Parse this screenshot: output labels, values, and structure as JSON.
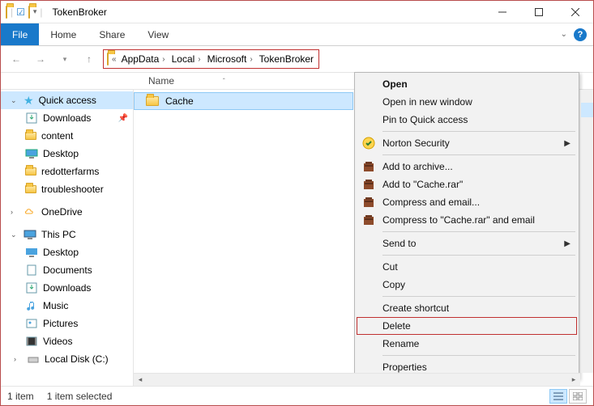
{
  "window": {
    "title": "TokenBroker"
  },
  "ribbon": {
    "file": "File",
    "tabs": [
      "Home",
      "Share",
      "View"
    ]
  },
  "breadcrumb": {
    "overflow": "«",
    "parts": [
      "AppData",
      "Local",
      "Microsoft",
      "TokenBroker"
    ]
  },
  "columns": {
    "name": "Name"
  },
  "nav": {
    "quick": {
      "label": "Quick access",
      "items": [
        {
          "label": "Downloads",
          "pinned": true
        },
        {
          "label": "content"
        },
        {
          "label": "Desktop"
        },
        {
          "label": "redotterfarms"
        },
        {
          "label": "troubleshooter"
        }
      ]
    },
    "onedrive": {
      "label": "OneDrive"
    },
    "thispc": {
      "label": "This PC",
      "items": [
        {
          "label": "Desktop"
        },
        {
          "label": "Documents"
        },
        {
          "label": "Downloads"
        },
        {
          "label": "Music"
        },
        {
          "label": "Pictures"
        },
        {
          "label": "Videos"
        },
        {
          "label": "Local Disk (C:)"
        }
      ]
    }
  },
  "files": [
    {
      "name": "Cache"
    }
  ],
  "context_menu": {
    "open": "Open",
    "open_new": "Open in new window",
    "pin_quick": "Pin to Quick access",
    "norton": "Norton Security",
    "add_archive": "Add to archive...",
    "add_cache": "Add to \"Cache.rar\"",
    "compress_email": "Compress and email...",
    "compress_cache_email": "Compress to \"Cache.rar\" and email",
    "send_to": "Send to",
    "cut": "Cut",
    "copy": "Copy",
    "create_shortcut": "Create shortcut",
    "delete": "Delete",
    "rename": "Rename",
    "properties": "Properties"
  },
  "status": {
    "count": "1 item",
    "selected": "1 item selected"
  }
}
